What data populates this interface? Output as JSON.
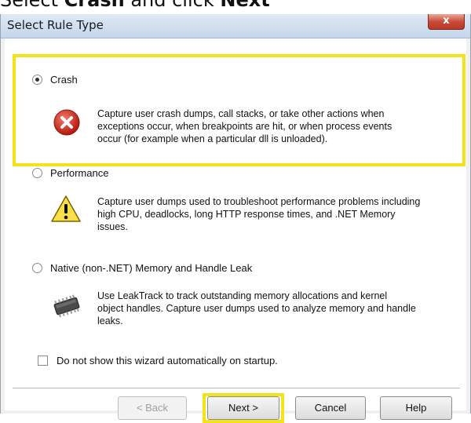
{
  "caption": {
    "part1": "Select ",
    "bold1": "Crash",
    "part2": " and click ",
    "bold2": "Next"
  },
  "dialog": {
    "title": "Select Rule Type",
    "close_glyph": "x"
  },
  "options": [
    {
      "label": "Crash",
      "selected": true,
      "icon": "error-icon",
      "description": [
        "Capture user crash dumps, call stacks, or take other actions when",
        "exceptions occur, when breakpoints are hit, or when process events",
        "occur (for example when a particular dll is unloaded)."
      ]
    },
    {
      "label": "Performance",
      "selected": false,
      "icon": "warning-icon",
      "description": [
        "Capture user dumps used to troubleshoot performance problems including",
        "high CPU, deadlocks, long HTTP response times, and .NET Memory",
        "issues."
      ]
    },
    {
      "label": "Native (non-.NET) Memory and Handle Leak",
      "selected": false,
      "icon": "chip-icon",
      "description": [
        "Use LeakTrack to track outstanding memory allocations and kernel",
        "object handles. Capture user dumps used to analyze memory and handle",
        "leaks."
      ]
    }
  ],
  "startup_checkbox": {
    "label": "Do not show this wizard automatically on startup.",
    "checked": false
  },
  "buttons": {
    "back": "< Back",
    "next": "Next >",
    "cancel": "Cancel",
    "help": "Help"
  },
  "colors": {
    "highlight": "#f5e31a"
  }
}
